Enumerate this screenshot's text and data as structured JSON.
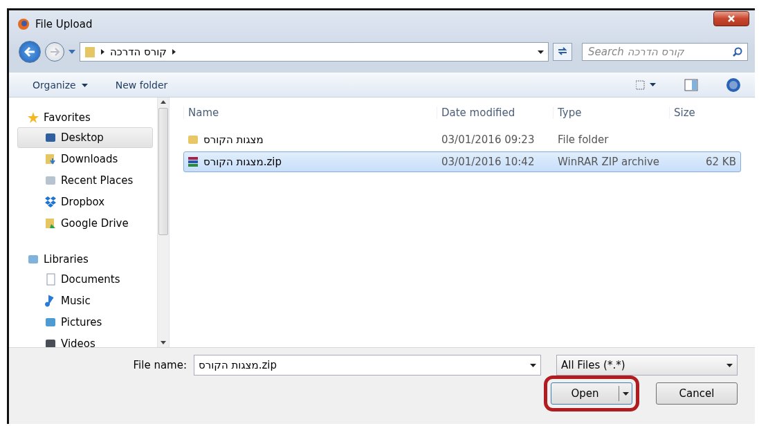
{
  "window": {
    "title": "File Upload"
  },
  "address": {
    "segments": [
      "קורס הדרכה"
    ]
  },
  "search": {
    "placeholder": "Search קורס הדרכה"
  },
  "toolbar": {
    "items": [
      {
        "label": "Organize",
        "kind": "menu"
      },
      {
        "label": "New folder",
        "kind": "plain"
      }
    ]
  },
  "sidebar": {
    "groups": [
      {
        "label": "Favorites",
        "kind": "star",
        "items": [
          {
            "label": "Desktop",
            "kind": "desktop",
            "selected": true
          },
          {
            "label": "Downloads",
            "kind": "downloads",
            "selected": false
          },
          {
            "label": "Recent Places",
            "kind": "recent",
            "selected": false
          },
          {
            "label": "Dropbox",
            "kind": "dropbox",
            "selected": false
          },
          {
            "label": "Google Drive",
            "kind": "drive",
            "selected": false
          }
        ]
      },
      {
        "label": "Libraries",
        "kind": "library",
        "items": [
          {
            "label": "Documents",
            "kind": "documents",
            "selected": false
          },
          {
            "label": "Music",
            "kind": "music",
            "selected": false
          },
          {
            "label": "Pictures",
            "kind": "pictures",
            "selected": false
          },
          {
            "label": "Videos",
            "kind": "videos",
            "selected": false
          }
        ]
      }
    ]
  },
  "table": {
    "columns": [
      "Name",
      "Date modified",
      "Type",
      "Size"
    ],
    "rows": [
      {
        "kind": "folder",
        "name": "מצגות הקורס",
        "date": "03/01/2016 09:23",
        "type": "File folder",
        "selected": false
      },
      {
        "kind": "archive",
        "name": "מצגות הקורס.zip",
        "date": "03/01/2016 10:42",
        "type": "WinRAR ZIP archive",
        "size": "62 KB",
        "selected": true
      }
    ]
  },
  "footer": {
    "file_name_label": "File name:",
    "file_name": "מצגות הקורס.zip",
    "file_type": "All Files (*.*)",
    "buttons": [
      {
        "label": "Open",
        "kind": "split",
        "highlighted": true
      },
      {
        "label": "Cancel",
        "kind": "plain",
        "highlighted": false
      }
    ]
  }
}
